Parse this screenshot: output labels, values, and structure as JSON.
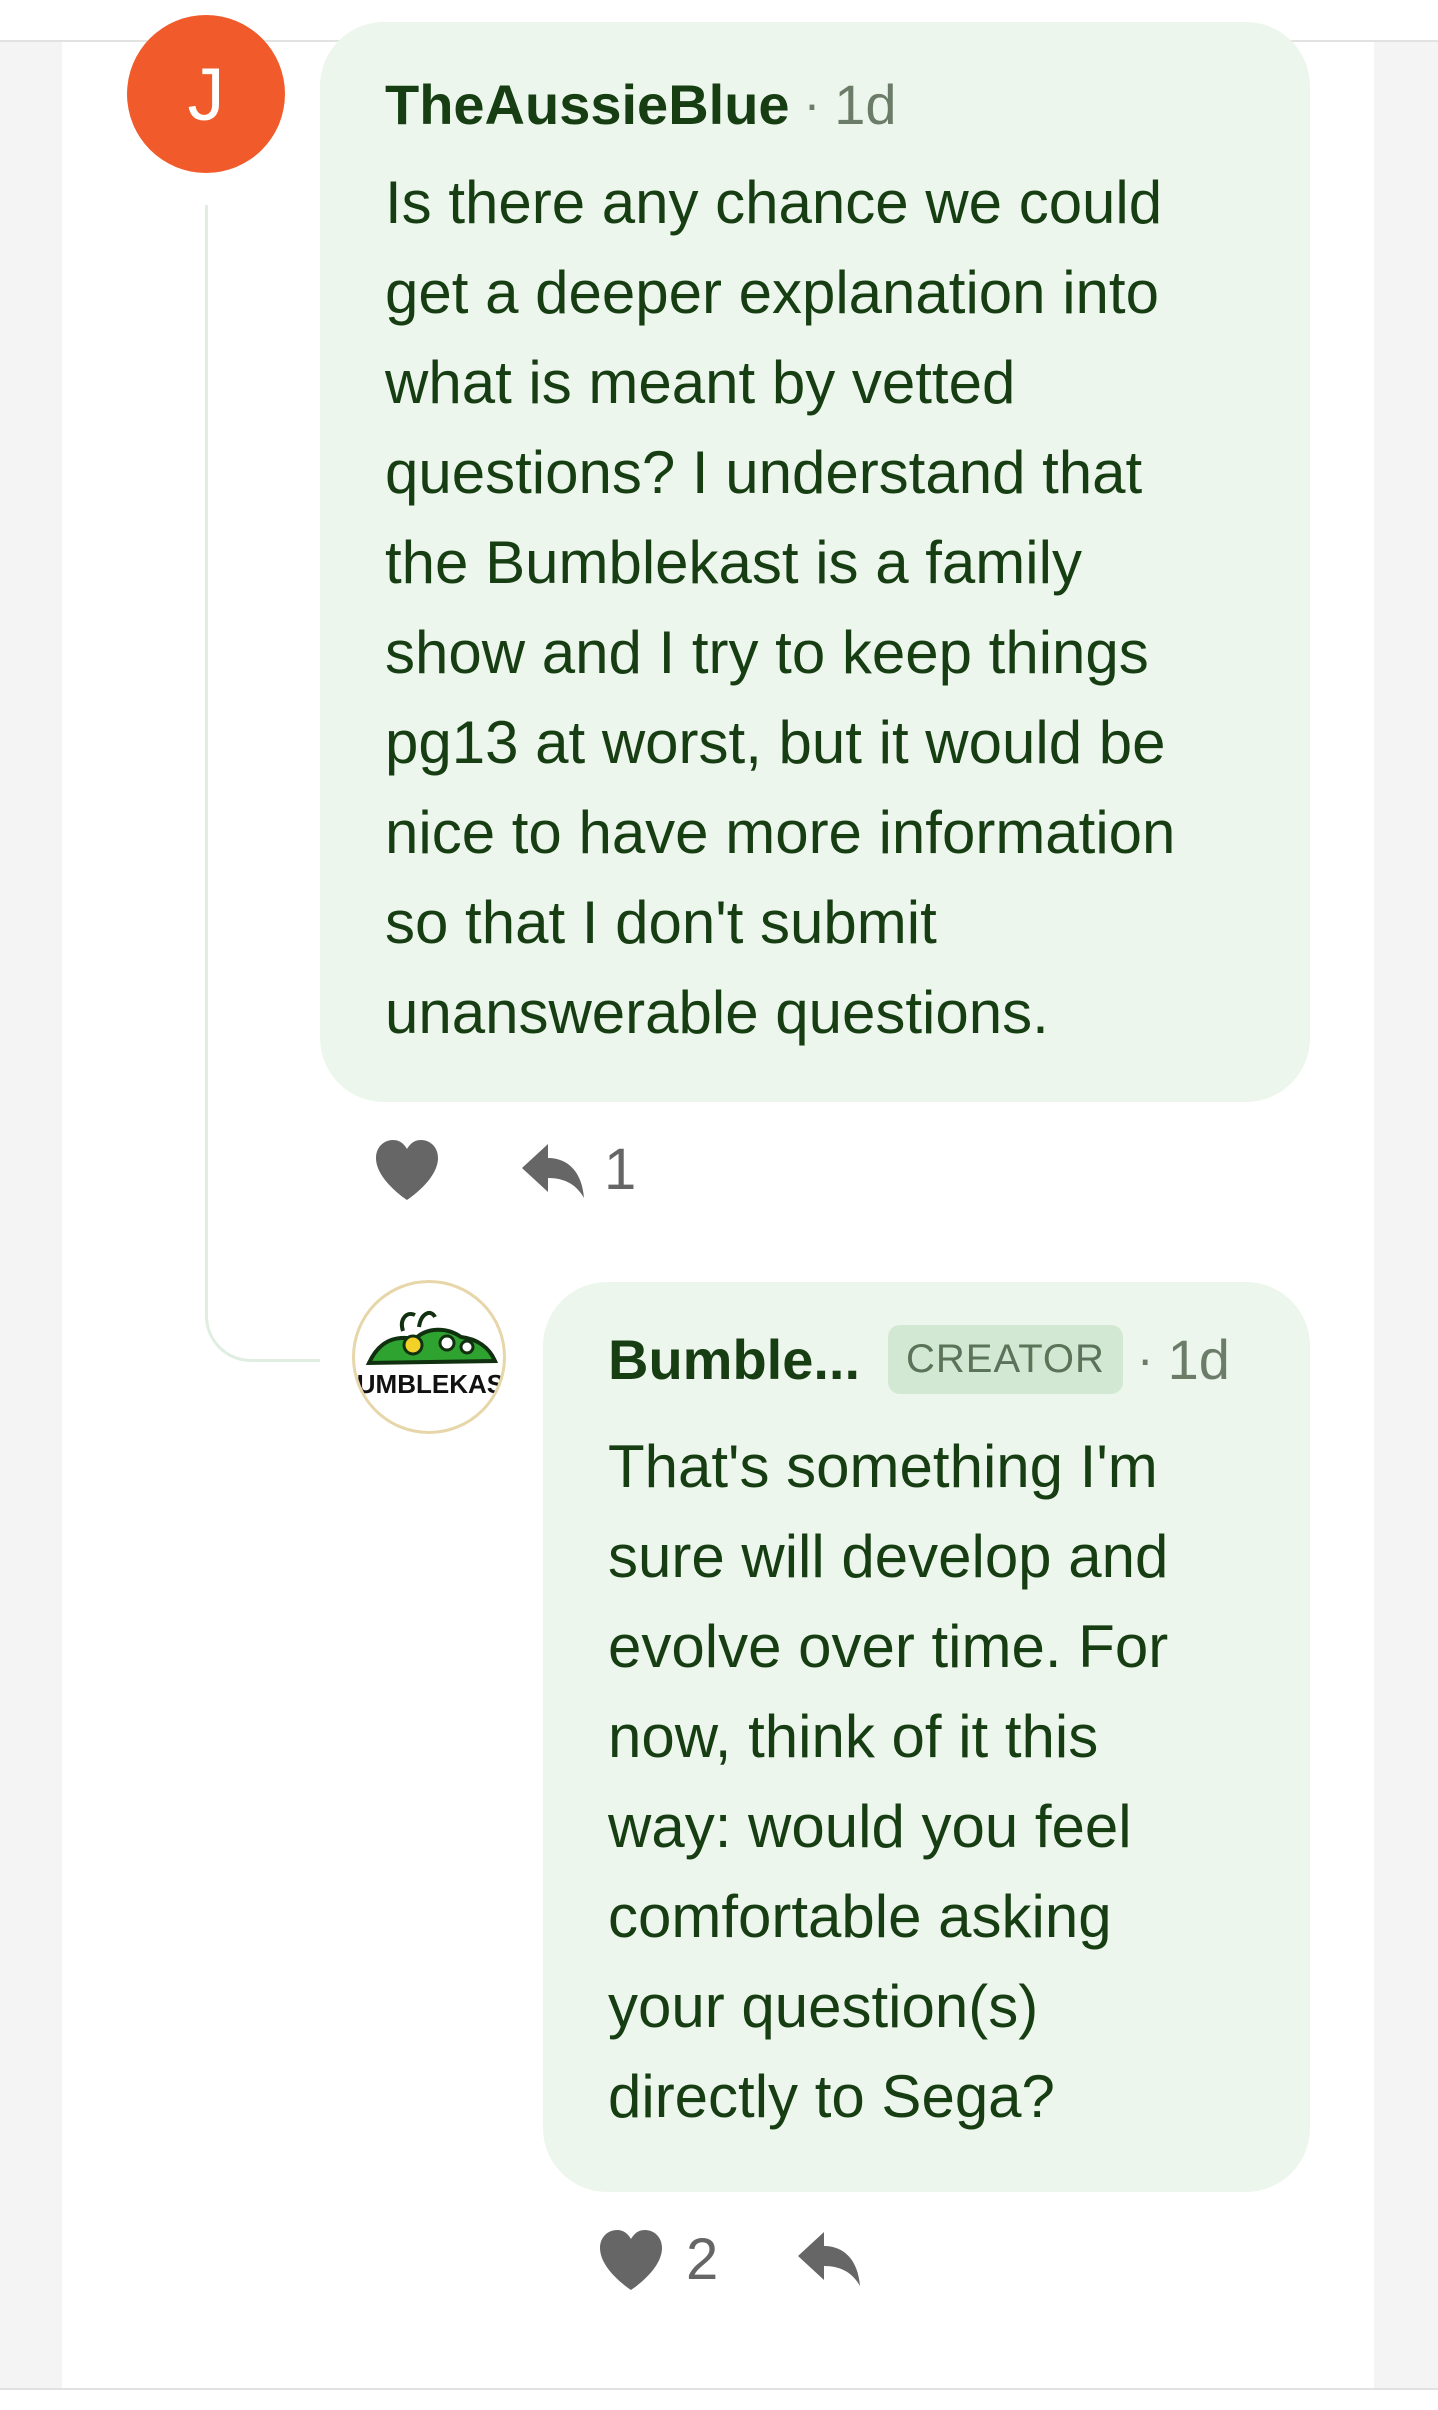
{
  "comments": [
    {
      "avatar_letter": "J",
      "author": "TheAussieBlue",
      "separator": "·",
      "time": "1d",
      "body_lines": [
        "Is there any chance we could",
        "get a deeper explanation into",
        "what is meant by vetted",
        "questions? I understand that",
        "the Bumblekast is a family",
        "show and I try to keep things",
        "pg13 at worst, but it would be",
        "nice to have more information",
        "so that I don't submit",
        "unanswerable questions."
      ],
      "like_count": "",
      "reply_count": "1",
      "colors": {
        "avatar": "#f15a2a",
        "bubble": "#ecf6ec",
        "text": "#173e13"
      }
    },
    {
      "avatar_logo_text": "BUMBLEKAST",
      "author": "Bumble...",
      "badge": "CREATOR",
      "separator": "·",
      "time": "1d",
      "body_lines": [
        "That's something I'm",
        "sure will develop and",
        "evolve over time. For",
        "now, think of it this",
        "way: would you feel",
        "comfortable asking",
        "your question(s)",
        "directly to Sega?"
      ],
      "like_count": "2",
      "reply_count": "",
      "colors": {
        "bubble": "#ecf6ec",
        "text": "#173e13",
        "badge_bg": "#d2e8d2"
      }
    }
  ],
  "icons": {
    "like": "heart-icon",
    "reply": "reply-arrow-icon"
  }
}
